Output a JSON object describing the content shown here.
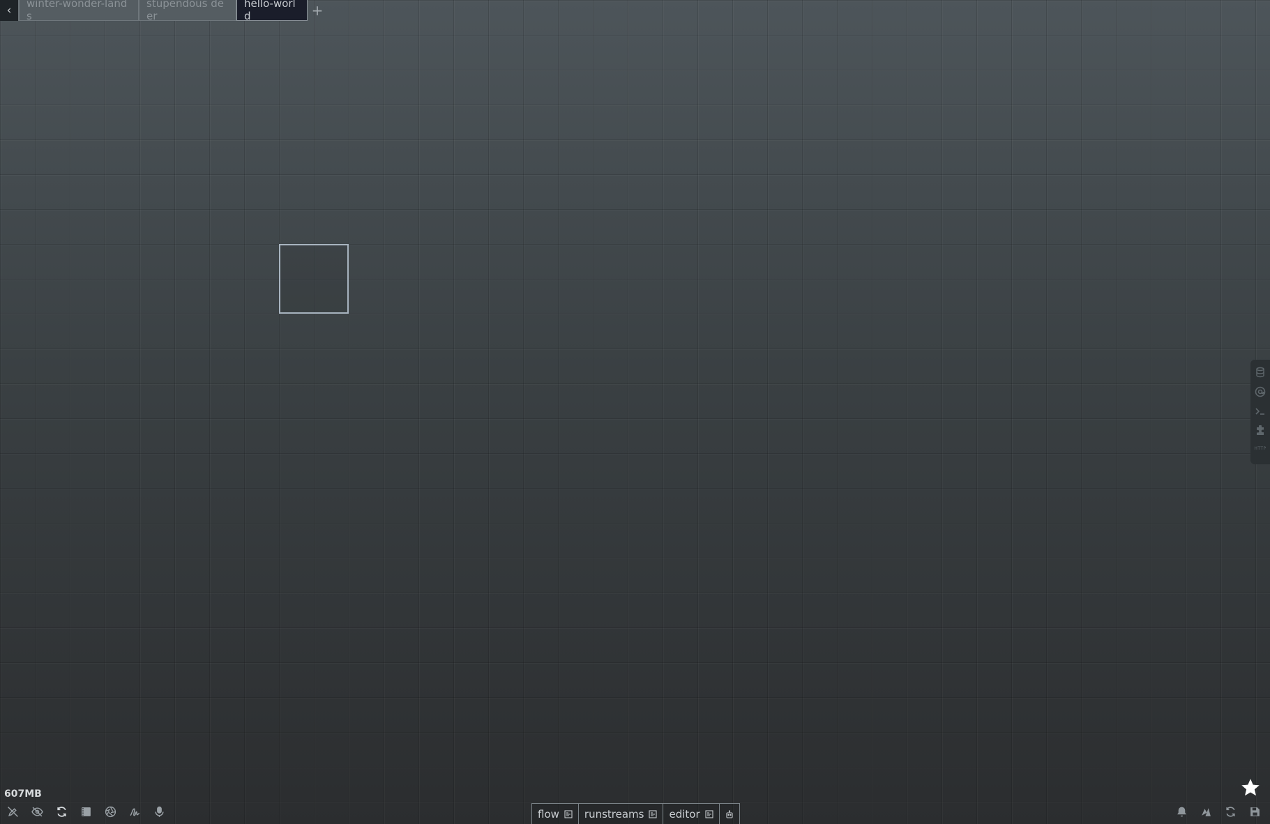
{
  "tabs": {
    "back_label": "‹",
    "items": [
      {
        "label": "winter-wonder-lands"
      },
      {
        "label": "stupendous deer"
      },
      {
        "label": "hello-world"
      }
    ],
    "add_label": "+"
  },
  "side_panel": {
    "icons": [
      "database-icon",
      "at-sign-icon",
      "terminal-icon",
      "puzzle-icon"
    ],
    "http_label": "HTTP"
  },
  "status": {
    "memory": "607MB"
  },
  "bottom_tabs": [
    {
      "label": "flow"
    },
    {
      "label": "runstreams"
    },
    {
      "label": "editor"
    }
  ],
  "colors": {
    "background_top": "#4d555a",
    "background_bottom": "#2b2d2f",
    "active_tab": "#1a1d2a",
    "selection_border": "#a8b4c0"
  }
}
